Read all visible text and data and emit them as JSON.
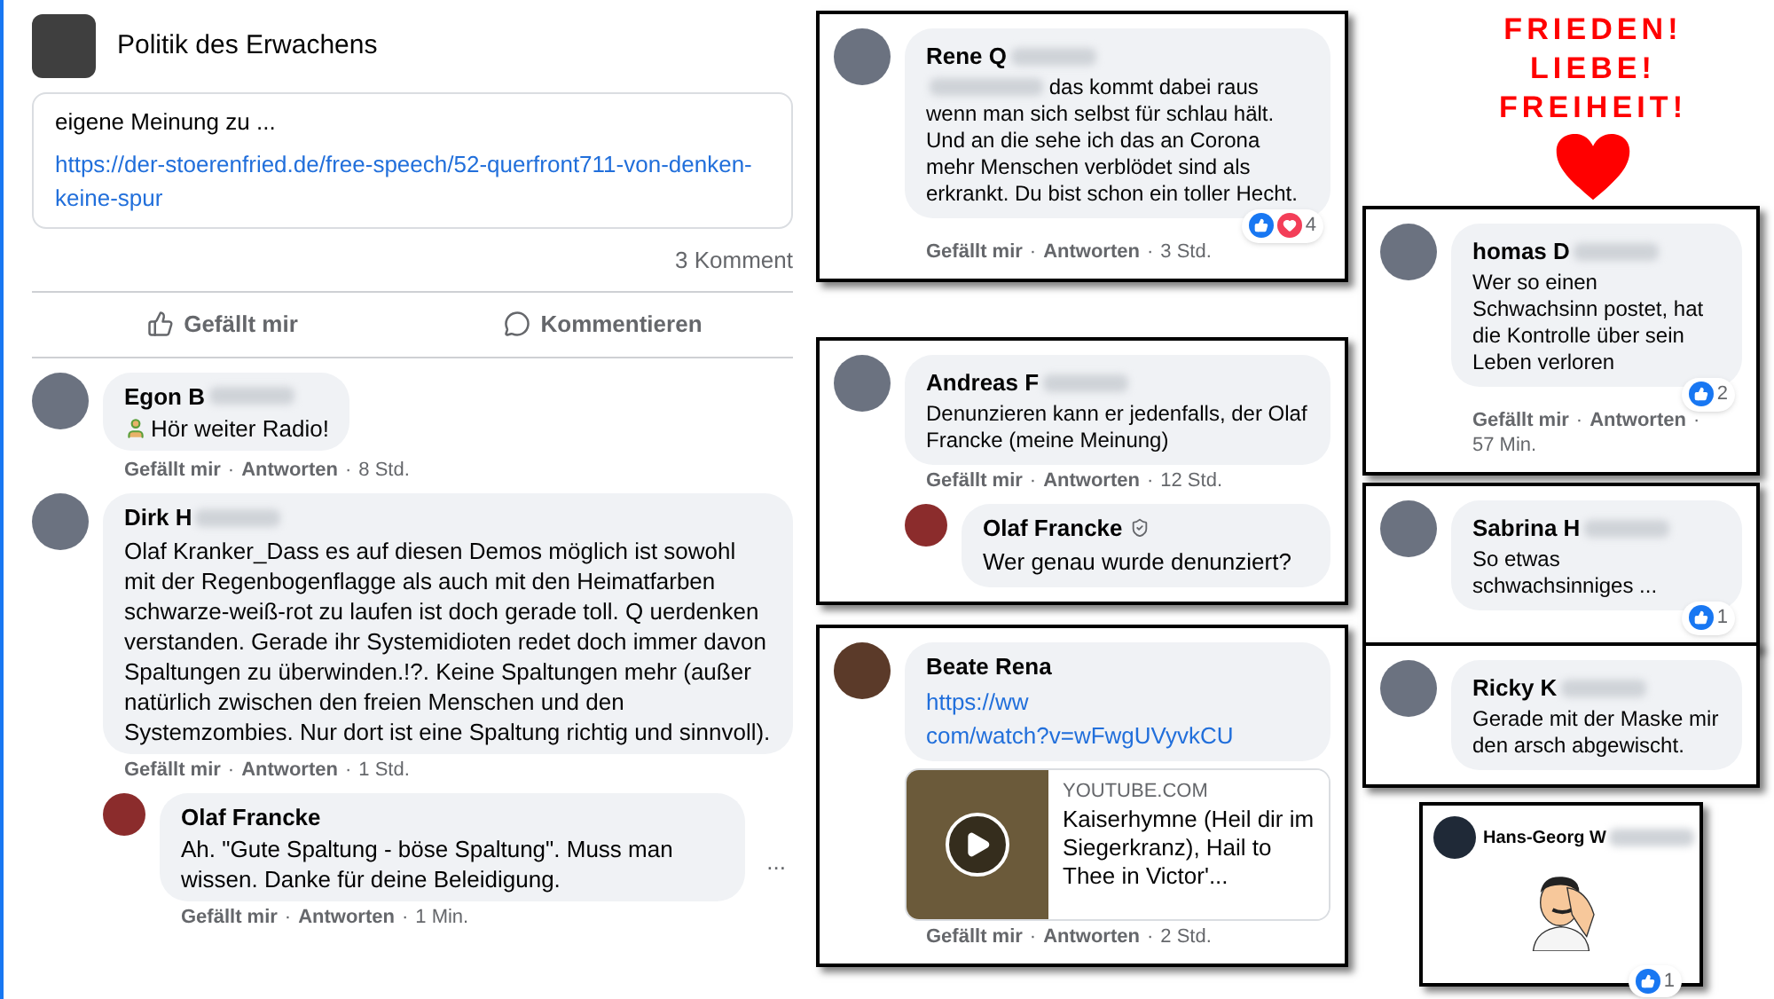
{
  "page": {
    "name": "Politik des Erwachens"
  },
  "post": {
    "snippet": "eigene Meinung zu ...",
    "link": "https://der-stoerenfried.de/free-speech/52-querfront711-von-denken-keine-spur",
    "comment_count": "3 Komment"
  },
  "actions": [
    "Gefällt mir",
    "Kommentieren"
  ],
  "comments": [
    {
      "author": "Egon B",
      "redacted": true,
      "emoji": true,
      "text": "Hör weiter Radio!",
      "meta": {
        "like": "Gefällt mir",
        "sep": "·",
        "reply": "Antworten",
        "time": "8 Std."
      }
    },
    {
      "author": "Dirk H",
      "redacted": true,
      "emoji": false,
      "text": "Olaf Kranker_Dass es auf diesen Demos möglich ist sowohl mit der Regenbogenflagge als auch mit den Heimatfarben schwarze-weiß-rot zu laufen ist doch gerade toll. Q uerdenken verstanden. Gerade ihr Systemidioten redet doch immer davon Spaltungen zu überwinden.!?. Keine Spaltungen mehr (außer natürlich zwischen den freien Menschen und den Systemzombies. Nur dort ist eine Spaltung richtig und sinnvoll).",
      "meta": {
        "like": "Gefällt mir",
        "sep": "·",
        "reply": "Antworten",
        "time": "1 Std."
      },
      "replies": [
        {
          "author": "Olaf Francke",
          "redacted": false,
          "text": "Ah. \"Gute Spaltung - böse Spaltung\". Muss man wissen. Danke für deine Beleidigung.",
          "meta": {
            "like": "Gefällt mir",
            "sep": "·",
            "reply": "Antworten",
            "time": "1 Min."
          },
          "more": "..."
        }
      ]
    }
  ],
  "slogan": [
    "FRIEDEN!",
    "LIEBE!",
    "FREIHEIT!"
  ],
  "cards": [
    {
      "kind": "comment",
      "author": "Rene Q",
      "redacted": true,
      "text_redacted": true,
      "text": "das kommt dabei raus wenn man sich selbst für schlau hält. Und an die sehe ich das an Corona mehr Menschen verblödet sind als erkrankt. Du bist schon ein toller Hecht.",
      "meta": {
        "like": "Gefällt mir",
        "sep": "·",
        "reply": "Antworten",
        "time": "3 Std."
      },
      "reactions": {
        "count": "4",
        "love": true
      }
    },
    {
      "kind": "comment",
      "author": "homas D",
      "redacted": true,
      "text_redacted": false,
      "text": "Wer so einen Schwachsinn postet, hat die Kontrolle über sein Leben verloren",
      "meta": {
        "like": "Gefällt mir",
        "sep": "·",
        "reply": "Antworten",
        "time": "57 Min."
      },
      "reactions": {
        "count": "2",
        "love": false
      }
    },
    {
      "kind": "comment",
      "author": "Andreas F",
      "redacted": true,
      "text_redacted": false,
      "text": "Denunzieren kann er jedenfalls, der Olaf Francke (meine Meinung)",
      "meta": {
        "like": "Gefällt mir",
        "sep": "·",
        "reply": "Antworten",
        "time": "12 Std."
      },
      "reply": {
        "author": "Olaf Francke",
        "verified": true,
        "text": "Wer genau wurde denunziert?"
      }
    },
    {
      "kind": "comment",
      "author": "Sabrina H",
      "redacted": true,
      "text_redacted": false,
      "text": "So etwas schwachsinniges ...",
      "reactions": {
        "count": "1",
        "love": false
      }
    },
    {
      "kind": "link",
      "author": "Beate Rena",
      "redacted": false,
      "link_parts": [
        "https://ww",
        "com/watch?v=wFwgUVyvkCU"
      ],
      "domain": "YOUTUBE.COM",
      "title": "Kaiserhymne (Heil dir im Siegerkranz), Hail to Thee in Victor'...",
      "meta": {
        "like": "Gefällt mir",
        "sep": "·",
        "reply": "Antworten",
        "time": "2 Std."
      }
    },
    {
      "kind": "comment",
      "author": "Ricky K",
      "redacted": true,
      "text_redacted": false,
      "text": "Gerade mit der Maske mir den arsch abgewischt."
    },
    {
      "kind": "sticker",
      "author": "Hans-Georg W",
      "redacted": true,
      "reactions": {
        "count": "1",
        "love": false
      }
    }
  ]
}
